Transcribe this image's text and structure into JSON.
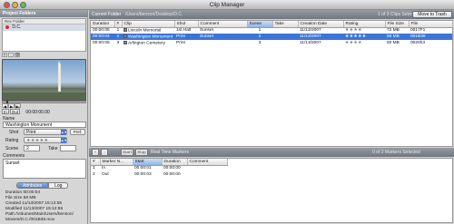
{
  "window": {
    "title": "Clip Manager"
  },
  "project": {
    "header": "Project Folders",
    "column": "Rec  Folder",
    "folders": [
      {
        "name": "D.C."
      }
    ],
    "tools": [
      "+",
      "-",
      "⚙"
    ]
  },
  "viewer": {
    "timecode": "00:00:00.00",
    "in_label": "In",
    "out_label": "Out"
  },
  "metadata": {
    "name_label": "Name",
    "name_value": "Washington Monument",
    "shot_label": "Shot",
    "shot_value": "Print",
    "pref_label": "Pref.",
    "rating_label": "Rating",
    "rating_stars": "★★★★★",
    "rating_value": 5,
    "scene_label": "Scene",
    "scene_value": "2",
    "take_label": "Take",
    "take_value": "",
    "comments_label": "Comments",
    "comments_value": "Sunset"
  },
  "tabs": {
    "attributes": "Attributes",
    "log": "Log"
  },
  "attributes": {
    "duration": "Duration  00:00:04",
    "file_size": "File Size  58 MB",
    "created": "Created  11/13/2007 15:12:55",
    "modified": "Modified  11/13/2007 15:12:55",
    "path_line1": "Path  /Volumes/Main/Users/benson/",
    "path_line2": "Movies/D.C./001B38.mov"
  },
  "browser": {
    "current_folder_label": "Current Folder",
    "current_folder_path": "/Users/benson/Desktop/D.C.",
    "selection_status": "1 of 3 Clips Selected",
    "move_to_trash": "Move to Trash"
  },
  "clip_table": {
    "columns": [
      "Duration",
      "#",
      "Clip",
      "Shot",
      "Comment",
      "Scene",
      "Take",
      "Creation Date",
      "Rating",
      "File Size",
      "File"
    ],
    "rows": [
      {
        "duration": "00:00:05",
        "num": "1",
        "clip": "Lincoln Memorial",
        "shot": "1st Half",
        "comment": "Sunset",
        "scene": "1",
        "take": "",
        "date": "11/13/2007",
        "rating": "★★★★",
        "rating_value": 4,
        "size": "72 MB",
        "file": "0017F1"
      },
      {
        "duration": "00:00:04",
        "num": "2",
        "clip": "Washington Monument",
        "shot": "Print",
        "comment": "Sunset",
        "scene": "2",
        "take": "",
        "date": "11/13/2007",
        "rating": "★★★★★",
        "rating_value": 5,
        "size": "58 MB",
        "file": "001B38"
      },
      {
        "duration": "00:00:05",
        "num": "3",
        "clip": "Arlington Cemetery",
        "shot": "Print",
        "comment": "",
        "scene": "3",
        "take": "",
        "date": "11/13/2007",
        "rating": "★★★★",
        "rating_value": 4,
        "size": "60 MB",
        "file": "0020h3"
      }
    ]
  },
  "marker_bar": {
    "add": "+",
    "remove": "-",
    "start": "Start",
    "stop": "Stop",
    "realtime_label": "Real Time Markers",
    "selection_status": "0 of 2 Markers Selected"
  },
  "marker_table": {
    "columns": [
      "#",
      "Marker N...",
      "Start",
      "Duration",
      "Comment"
    ],
    "rows": [
      {
        "num": "1",
        "name": "In",
        "start": "00:00:01",
        "duration": "00:00:00",
        "comment": ""
      },
      {
        "num": "2",
        "name": "Out",
        "start": "00:00:03",
        "duration": "00:00:00",
        "comment": ""
      }
    ]
  },
  "colors": {
    "selection": "#3d74d7",
    "header_gradient": "#7f868e",
    "tab_active": "#4d82d2"
  }
}
